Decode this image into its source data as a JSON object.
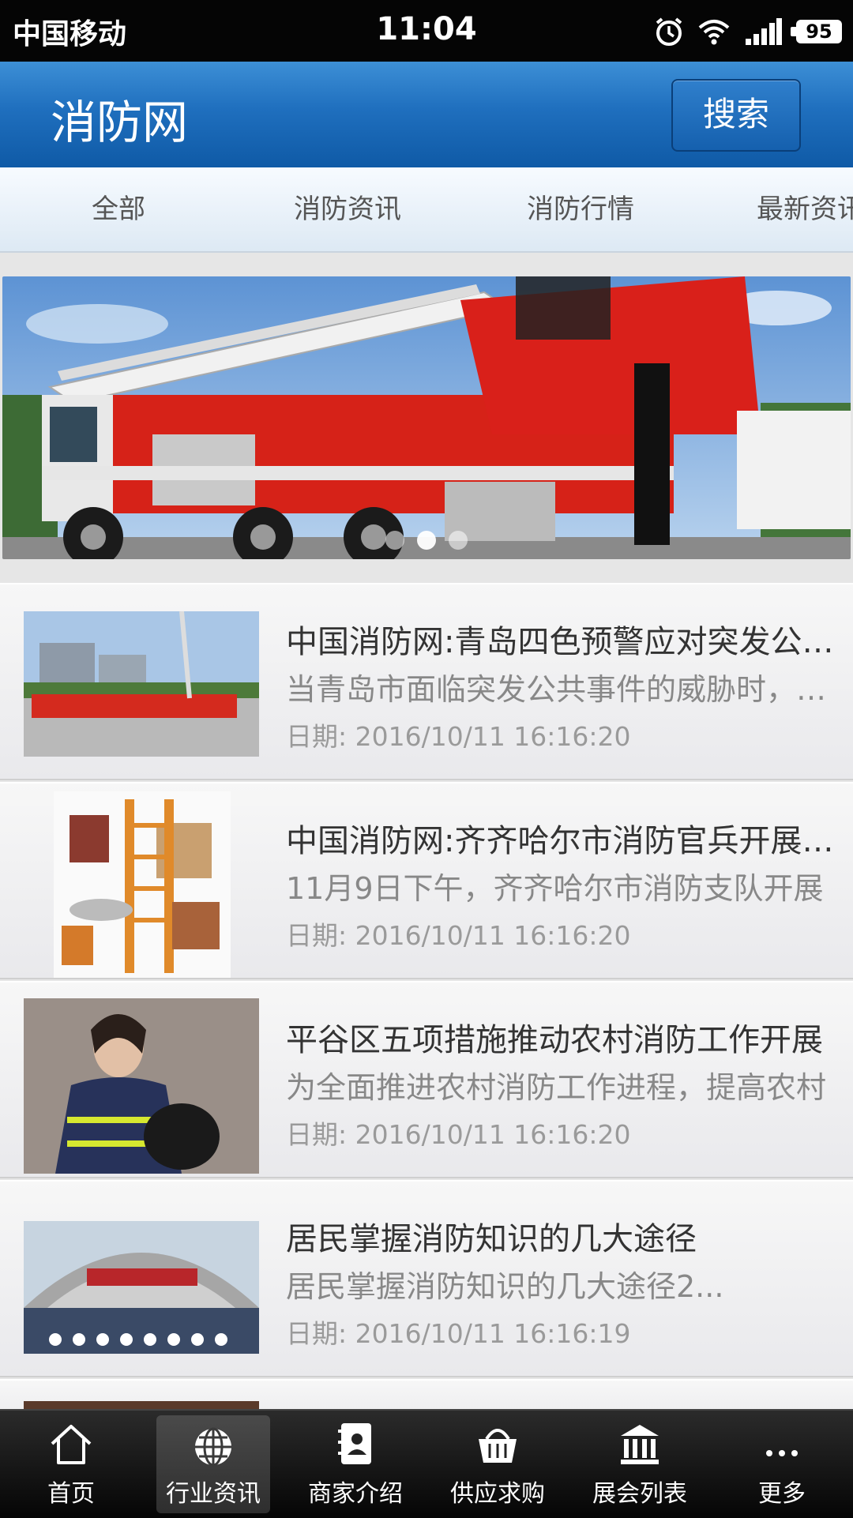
{
  "status_bar": {
    "carrier": "中国移动",
    "time": "11:04",
    "battery": "95"
  },
  "header": {
    "title": "消防网",
    "search_label": "搜索"
  },
  "tabs": [
    {
      "label": "全部"
    },
    {
      "label": "消防资讯"
    },
    {
      "label": "消防行情"
    },
    {
      "label": "最新资讯"
    }
  ],
  "banner": {
    "slide_count": 3,
    "active_slide": 2
  },
  "news": [
    {
      "title": "中国消防网:青岛四色预警应对突发公共事件",
      "summary": "当青岛市面临突发公共事件的威胁时，青岛市",
      "date": "日期: 2016/10/11 16:16:20"
    },
    {
      "title": "中国消防网:齐齐哈尔市消防官兵开展演练",
      "summary": "11月9日下午，齐齐哈尔市消防支队开展",
      "date": "日期: 2016/10/11 16:16:20"
    },
    {
      "title": "平谷区五项措施推动农村消防工作开展",
      "summary": "为全面推进农村消防工作进程，提高农村",
      "date": "日期: 2016/10/11 16:16:20"
    },
    {
      "title": "居民掌握消防知识的几大途径",
      "summary": "居民掌握消防知识的几大途径2...",
      "date": "日期: 2016/10/11 16:16:19"
    }
  ],
  "bottom_nav": [
    {
      "label": "首页",
      "icon": "home-icon"
    },
    {
      "label": "行业资讯",
      "icon": "globe-icon"
    },
    {
      "label": "商家介绍",
      "icon": "contact-book-icon"
    },
    {
      "label": "供应求购",
      "icon": "basket-icon"
    },
    {
      "label": "展会列表",
      "icon": "building-icon"
    },
    {
      "label": "更多",
      "icon": "more-icon"
    }
  ],
  "colors": {
    "header_blue": "#1f6fbe",
    "nav_dark": "#111111"
  }
}
